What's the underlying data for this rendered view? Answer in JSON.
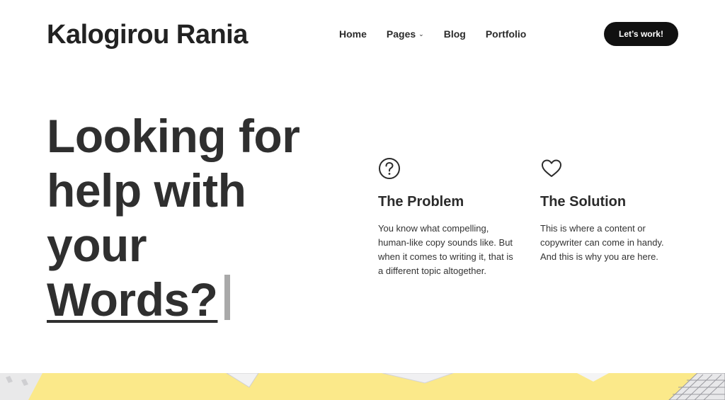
{
  "header": {
    "brand": "Kalogirou Rania",
    "nav": [
      {
        "label": "Home"
      },
      {
        "label": "Pages",
        "icon": "chevron-down-icon"
      },
      {
        "label": "Blog"
      },
      {
        "label": "Portfolio"
      }
    ],
    "cta_label": "Let’s work!"
  },
  "hero": {
    "lines": [
      "Looking for",
      "help with",
      "your"
    ],
    "typed_word": "Words?"
  },
  "cards": [
    {
      "icon": "question-circle-icon",
      "title": "The Problem",
      "text": "You know what compelling, human-like copy sounds like. But when it comes to writing it, that is a different topic altogether."
    },
    {
      "icon": "heart-icon",
      "title": "The Solution",
      "text": "This is where a content or copywriter can come in handy. And this is why you are here."
    }
  ],
  "colors": {
    "cta_bg": "#111111",
    "banner_bg": "#fbe98a",
    "cursor": "#a9a9a9"
  }
}
